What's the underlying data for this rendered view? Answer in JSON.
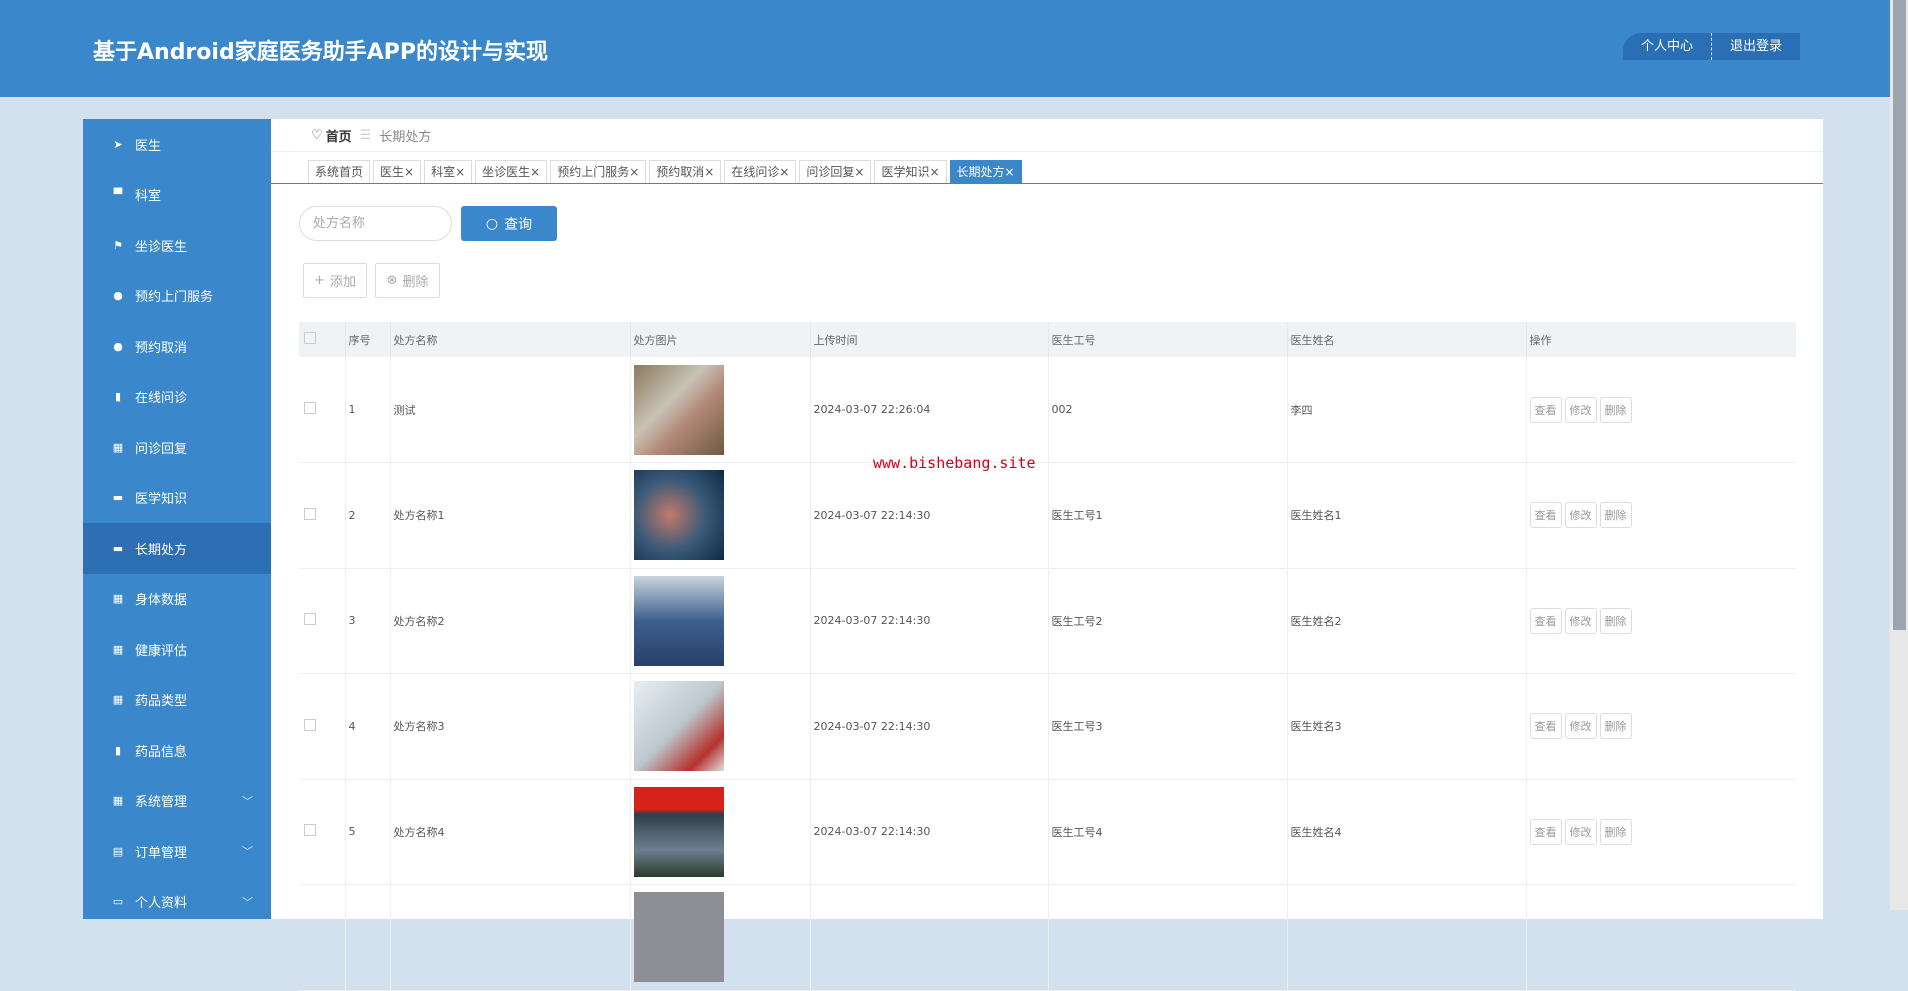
{
  "header": {
    "title": "基于Android家庭医务助手APP的设计与实现",
    "user_center": "个人中心",
    "logout": "退出登录"
  },
  "sidebar": {
    "items": [
      {
        "label": "医生",
        "icon": "paper-plane-icon",
        "glyph": "➤"
      },
      {
        "label": "科室",
        "icon": "sign-icon",
        "glyph": "▀"
      },
      {
        "label": "坐诊医生",
        "icon": "flag-icon",
        "glyph": "⚑"
      },
      {
        "label": "预约上门服务",
        "icon": "user-icon",
        "glyph": "●"
      },
      {
        "label": "预约取消",
        "icon": "pin-icon",
        "glyph": "●"
      },
      {
        "label": "在线问诊",
        "icon": "bar-chart-icon",
        "glyph": "▮"
      },
      {
        "label": "问诊回复",
        "icon": "grid-icon",
        "glyph": "▦"
      },
      {
        "label": "医学知识",
        "icon": "monitor-icon",
        "glyph": "▬"
      },
      {
        "label": "长期处方",
        "icon": "comment-icon",
        "glyph": "▬"
      },
      {
        "label": "身体数据",
        "icon": "grid-icon",
        "glyph": "▦"
      },
      {
        "label": "健康评估",
        "icon": "grid-icon",
        "glyph": "▦"
      },
      {
        "label": "药品类型",
        "icon": "grid-icon",
        "glyph": "▦"
      },
      {
        "label": "药品信息",
        "icon": "book-icon",
        "glyph": "▮"
      },
      {
        "label": "系统管理",
        "icon": "grid-icon",
        "glyph": "▦",
        "expandable": true
      },
      {
        "label": "订单管理",
        "icon": "clipboard-icon",
        "glyph": "▤",
        "expandable": true
      },
      {
        "label": "个人资料",
        "icon": "card-icon",
        "glyph": "▭",
        "expandable": true
      }
    ],
    "active_index": 8
  },
  "breadcrumb": {
    "home": "首页",
    "current": "长期处方"
  },
  "tabs": [
    {
      "label": "系统首页"
    },
    {
      "label": "医生×"
    },
    {
      "label": "科室×"
    },
    {
      "label": "坐诊医生×"
    },
    {
      "label": "预约上门服务×"
    },
    {
      "label": "预约取消×"
    },
    {
      "label": "在线问诊×"
    },
    {
      "label": "问诊回复×"
    },
    {
      "label": "医学知识×"
    },
    {
      "label": "长期处方×",
      "active": true
    }
  ],
  "search": {
    "placeholder": "处方名称",
    "button": "查询"
  },
  "actions": {
    "add": "添加",
    "delete": "删除"
  },
  "table": {
    "headers": [
      "序号",
      "处方名称",
      "处方图片",
      "上传时间",
      "医生工号",
      "医生姓名",
      "操作"
    ],
    "rows": [
      {
        "no": "1",
        "name": "测试",
        "time": "2024-03-07 22:26:04",
        "doc_id": "002",
        "doc_name": "李四"
      },
      {
        "no": "2",
        "name": "处方名称1",
        "time": "2024-03-07 22:14:30",
        "doc_id": "医生工号1",
        "doc_name": "医生姓名1"
      },
      {
        "no": "3",
        "name": "处方名称2",
        "time": "2024-03-07 22:14:30",
        "doc_id": "医生工号2",
        "doc_name": "医生姓名2"
      },
      {
        "no": "4",
        "name": "处方名称3",
        "time": "2024-03-07 22:14:30",
        "doc_id": "医生工号3",
        "doc_name": "医生姓名3"
      },
      {
        "no": "5",
        "name": "处方名称4",
        "time": "2024-03-07 22:14:30",
        "doc_id": "医生工号4",
        "doc_name": "医生姓名4"
      }
    ],
    "ops": {
      "view": "查看",
      "edit": "修改",
      "delete": "删除"
    }
  },
  "watermark": "www.bishebang.site"
}
